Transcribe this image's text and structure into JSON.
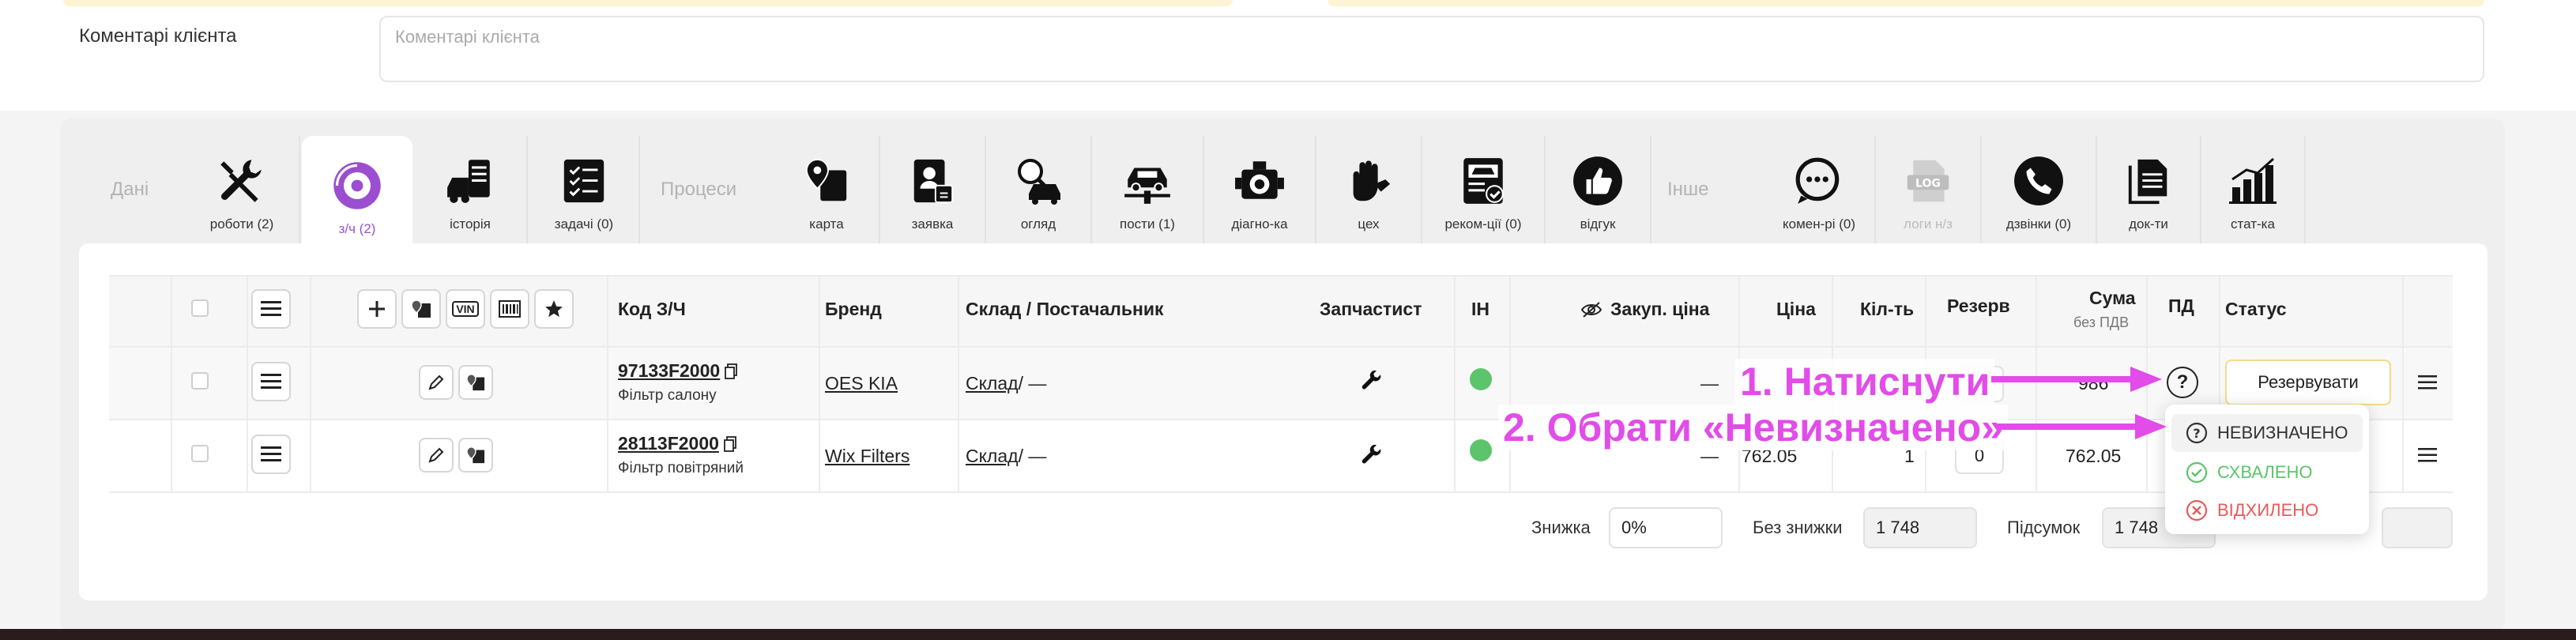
{
  "comments": {
    "label": "Коментарі клієнта",
    "placeholder": "Коментарі клієнта"
  },
  "tabs": {
    "group_data": "Дані",
    "group_process": "Процеси",
    "group_other": "Інше",
    "works": "роботи (2)",
    "parts": "з/ч (2)",
    "history": "історія",
    "tasks": "задачі (0)",
    "map": "карта",
    "request": "заявка",
    "inspection": "огляд",
    "posts": "пости (1)",
    "diagnostics": "діагно-ка",
    "shop": "цех",
    "recommendations": "реком-ції (0)",
    "feedback": "відгук",
    "comments": "комен-рі (0)",
    "logs": "логи н/з",
    "calls": "дзвінки (0)",
    "documents": "док-ти",
    "stats": "стат-ка",
    "log_badge": "LOG"
  },
  "table": {
    "headers": {
      "code": "Код З/Ч",
      "brand": "Бренд",
      "warehouse": "Склад / Постачальник",
      "parts_person": "Запчастист",
      "in": "ІН",
      "purchase_price": "Закуп. ціна",
      "price": "Ціна",
      "qty": "Кіл-ть",
      "reserve": "Резерв",
      "sum": "Сума",
      "sum_sub": "без ПДВ",
      "pd": "ПД",
      "status": "Статус"
    },
    "vin_badge": "VIN",
    "rows": [
      {
        "code": "97133F2000",
        "name": "Фільтр салону",
        "brand": "OES KIA",
        "warehouse_link": "Склад",
        "warehouse_rest": " / —",
        "purchase": "—",
        "price": "",
        "qty": "",
        "reserve": "",
        "sum": "986",
        "status_button": "Резервувати"
      },
      {
        "code": "28113F2000",
        "name": "Фільтр повітряний",
        "brand": "Wix Filters",
        "warehouse_link": "Склад",
        "warehouse_rest": " / —",
        "purchase": "—",
        "price": "762.05",
        "qty": "1",
        "reserve": "0",
        "sum": "762.05",
        "status_button": ""
      }
    ]
  },
  "totals": {
    "discount_label": "Знижка",
    "discount_value": "0%",
    "no_discount_label": "Без знижки",
    "no_discount_value": "1 748",
    "total_label": "Підсумок",
    "total_value": "1 748"
  },
  "dropdown": {
    "items": [
      {
        "label": "НЕВИЗНАЧЕНО",
        "color": "#333333"
      },
      {
        "label": "СХВАЛЕНО",
        "color": "#5cc46b"
      },
      {
        "label": "ВІДХИЛЕНО",
        "color": "#e85a5a"
      }
    ]
  },
  "annotations": {
    "step1": "1. Натиснути",
    "step2": "2. Обрати «Невизначено»",
    "color": "#e24ce8"
  },
  "colors": {
    "accent": "#9b4fd0",
    "reserve_border": "#f5d98a",
    "status_green": "#5cc46b"
  }
}
